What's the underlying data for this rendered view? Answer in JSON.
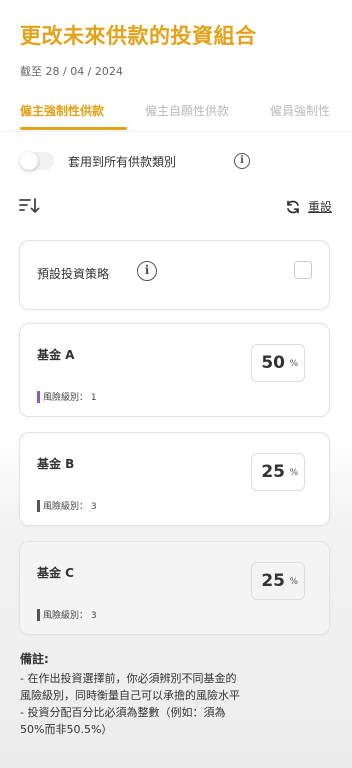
{
  "header": {
    "title": "更改未來供款的投資組合",
    "as_of": "截至 28 / 04 / 2024"
  },
  "tabs": [
    {
      "label": "僱主強制性供款",
      "active": true
    },
    {
      "label": "僱主自願性供款",
      "active": false
    },
    {
      "label": "僱員強制性",
      "active": false
    }
  ],
  "apply_all": {
    "label": "套用到所有供款類別",
    "enabled": false
  },
  "toolbar": {
    "reset_label": "重設"
  },
  "strategy": {
    "label": "預設投資策略",
    "checked": false
  },
  "funds": [
    {
      "name": "基金 A",
      "percent": "50",
      "unit": "%",
      "risk": "風險級別： 1",
      "risk_color": "#8a5cc7"
    },
    {
      "name": "基金 B",
      "percent": "25",
      "unit": "%",
      "risk": "風險級別： 3",
      "risk_color": "#555555"
    },
    {
      "name": "基金 C",
      "percent": "25",
      "unit": "%",
      "risk": "風險級別： 3",
      "risk_color": "#555555"
    }
  ],
  "remarks": {
    "title": "備註:",
    "lines": [
      "- 在作出投資選擇前，你必須辨別不同基金的",
      "風險級別，同時衡量自己可以承擔的風險水平",
      "- 投資分配百分比必須為整數（例如：須為",
      "50%而非50.5%）"
    ]
  },
  "colors": {
    "accent": "#e3a21a"
  }
}
